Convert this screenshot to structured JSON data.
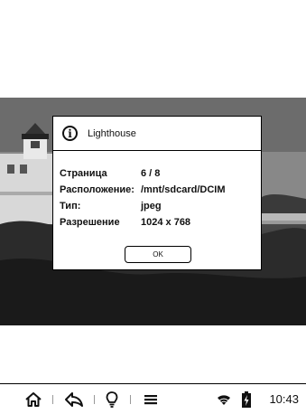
{
  "dialog": {
    "title": "Lighthouse",
    "icon": "info-icon",
    "fields": [
      {
        "label": "Страница",
        "value": "6 / 8"
      },
      {
        "label": "Расположение:",
        "value": "/mnt/sdcard/DCIM"
      },
      {
        "label": "Тип:",
        "value": "jpeg"
      },
      {
        "label": "Разрешение",
        "value": "1024 x 768"
      }
    ],
    "ok_label": "OK"
  },
  "toolbar": {
    "icons": [
      "home-icon",
      "back-icon",
      "light-bulb-icon",
      "menu-icon",
      "wifi-icon",
      "battery-icon"
    ],
    "time": "10:43"
  }
}
